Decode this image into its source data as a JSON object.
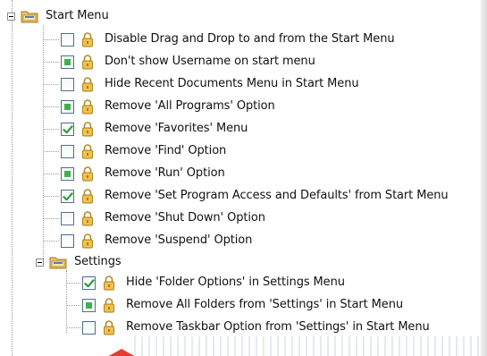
{
  "tree": {
    "start_menu": {
      "label": "Start Menu",
      "expanded": true,
      "items": [
        {
          "label": "Disable Drag and Drop to and from the Start Menu",
          "state": "unchecked"
        },
        {
          "label": "Don't show Username on start menu",
          "state": "partial"
        },
        {
          "label": "Hide Recent Documents Menu in Start Menu",
          "state": "unchecked"
        },
        {
          "label": "Remove 'All Programs' Option",
          "state": "partial"
        },
        {
          "label": "Remove 'Favorites' Menu",
          "state": "checked"
        },
        {
          "label": "Remove 'Find' Option",
          "state": "unchecked"
        },
        {
          "label": "Remove 'Run' Option",
          "state": "partial"
        },
        {
          "label": "Remove 'Set Program Access and Defaults' from Start Menu",
          "state": "checked"
        },
        {
          "label": "Remove 'Shut Down' Option",
          "state": "unchecked"
        },
        {
          "label": "Remove 'Suspend' Option",
          "state": "unchecked"
        }
      ]
    },
    "settings": {
      "label": "Settings",
      "expanded": true,
      "items": [
        {
          "label": "Hide 'Folder Options' in Settings Menu",
          "state": "checked"
        },
        {
          "label": "Remove All Folders from 'Settings' in Start Menu",
          "state": "partial"
        },
        {
          "label": "Remove Taskbar Option from 'Settings' in Start Menu",
          "state": "unchecked"
        }
      ]
    }
  },
  "colors": {
    "partial_fill": "#3cb34a",
    "check_mark": "#2f9a3a",
    "pointer": "#e63d2f"
  },
  "icons": {
    "folder": "folder-icon",
    "lock": "lock-icon",
    "expander": "collapse-icon"
  }
}
